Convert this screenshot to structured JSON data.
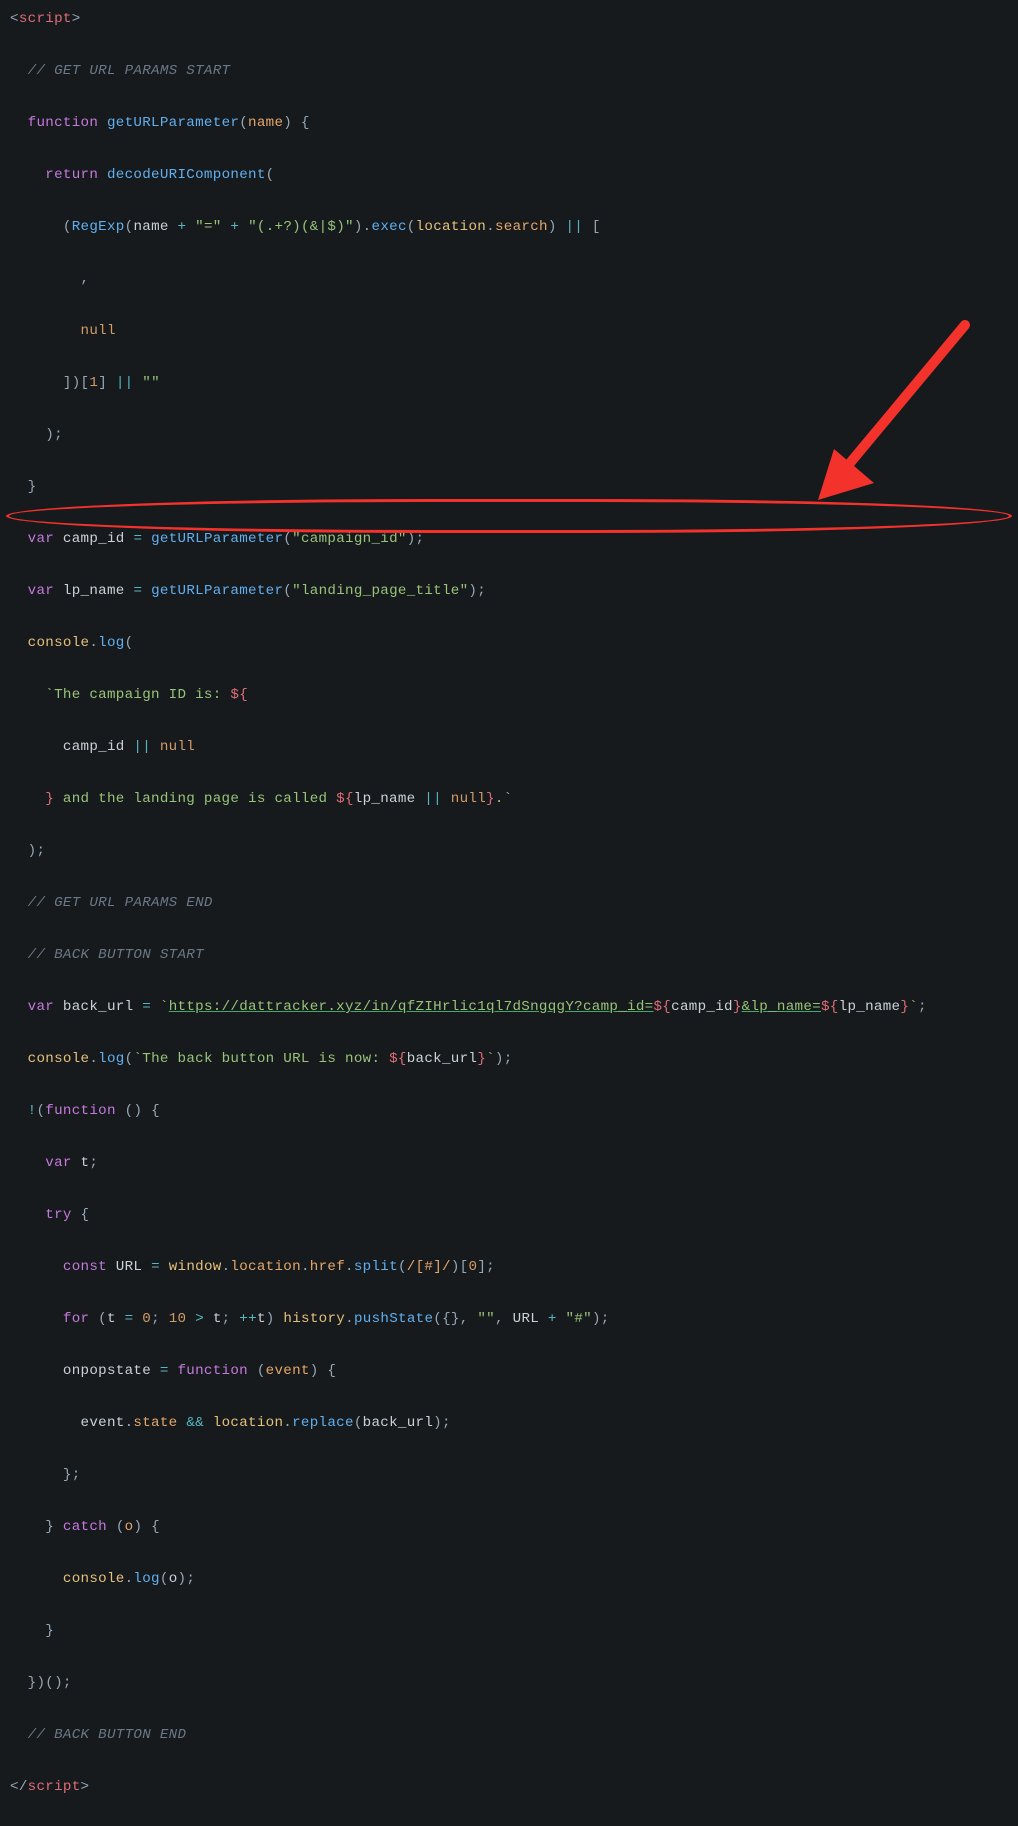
{
  "colors": {
    "bg": "#161a1d",
    "punc": "#96a7b6",
    "tag": "#e06c75",
    "comment": "#6b7886",
    "keyword": "#c678dd",
    "fn": "#61afef",
    "param": "#e5a66a",
    "string": "#98c379",
    "number": "#d19a66",
    "op": "#56b6c2",
    "builtin": "#e5c07b",
    "annotation_red": "#f3322c"
  },
  "tokens": {
    "open_tag_lt": "<",
    "open_tag_name": "script",
    "open_tag_gt": ">",
    "c_params_start": "// GET URL PARAMS START",
    "kw_function": "function",
    "fn_getURLParameter": "getURLParameter",
    "lp1_open": "(",
    "param_name": "name",
    "lp1_close": ") {",
    "kw_return": "return",
    "fn_decode": "decodeURIComponent",
    "lp2": "(",
    "lp3_open": "(",
    "fn_regexp": "RegExp",
    "lp4_open": "(",
    "re_name": "name",
    "op_plus1": " + ",
    "str_eq": "\"=\"",
    "op_plus2": " + ",
    "str_regex": "\"(.+?)(&|$)\"",
    "lp4_close": ")",
    "dot1": ".",
    "fn_exec": "exec",
    "lp5_open": "(",
    "var_location": "location",
    "dot2": ".",
    "prop_search": "search",
    "lp5_close": ")",
    "op_or1": " || ",
    "br1_open": "[",
    "comma_blank": ",",
    "kw_null1": "null",
    "br1_close": "])",
    "br_idx_open": "[",
    "num_1": "1",
    "br_idx_close": "]",
    "op_or2": " || ",
    "str_empty": "\"\"",
    "lp2_close": ");",
    "brace_close1": "}",
    "kw_var1": "var",
    "var_camp_id": "camp_id",
    "eq1": " = ",
    "fn_gup1": "getURLParameter",
    "lp6_open": "(",
    "str_campaign_id": "\"campaign_id\"",
    "lp6_close": ");",
    "kw_var2": "var",
    "var_lp_name": "lp_name",
    "eq2": " = ",
    "fn_gup2": "getURLParameter",
    "lp7_open": "(",
    "str_lpt": "\"landing_page_title\"",
    "lp7_close": ");",
    "var_console1": "console",
    "dot3": ".",
    "fn_log1": "log",
    "lp8_open": "(",
    "tpl_tick1": "`",
    "tpl_seg1": "The campaign ID is: ",
    "intp_open1": "${",
    "intp_body1a": "camp_id",
    "intp_or1": " || ",
    "intp_null1": "null",
    "intp_close1": "}",
    "tpl_seg2": " and the landing page is called ",
    "intp_open2": "${",
    "intp_body2a": "lp_name",
    "intp_or2": " || ",
    "intp_null2": "null",
    "intp_close2": "}",
    "tpl_seg3": ".",
    "tpl_tick2": "`",
    "lp8_close": ");",
    "c_params_end": "// GET URL PARAMS END",
    "c_back_start": "// BACK BUTTON START",
    "kw_var3": "var",
    "var_back_url": "back_url",
    "eq3": " = ",
    "tpl_tick3": "`",
    "tpl_url": "https://dattracker.xyz/in/qfZIHrlic1ql7dSngqgY?camp_id=",
    "intp_open3": "${",
    "intp_camp": "camp_id",
    "intp_close3": "}",
    "tpl_url2": "&lp_name=",
    "intp_open4": "${",
    "intp_lp": "lp_name",
    "intp_close4": "}",
    "tpl_tick4": "`",
    "semi1": ";",
    "var_console2": "console",
    "dot4": ".",
    "fn_log2": "log",
    "lp9_open": "(",
    "tpl_tick5": "`",
    "tpl_back_seg1": "The back button URL is now: ",
    "intp_open5": "${",
    "intp_bu": "back_url",
    "intp_close5": "}",
    "tpl_tick6": "`",
    "lp9_close": ");",
    "bang": "!",
    "lp10_open": "(",
    "kw_function2": "function",
    "lp11": " () {",
    "kw_var4": "var",
    "var_t": "t",
    "semi2": ";",
    "kw_try": "try",
    "brace2": " {",
    "kw_const": "const",
    "var_URL": "URL",
    "eq4": " = ",
    "var_window": "window",
    "dot5": ".",
    "prop_location": "location",
    "dot6": ".",
    "prop_href": "href",
    "dot7": ".",
    "fn_split": "split",
    "lp12_open": "(",
    "re_lit": "/[#]/",
    "lp12_close": ")[",
    "num_0": "0",
    "br2_close": "];",
    "kw_for": "for",
    "lp13_open": " (",
    "for_t": "t",
    "eq5": " = ",
    "num0b": "0",
    "semi3": "; ",
    "num10": "10",
    "op_gt": " > ",
    "for_t2": "t",
    "semi4": "; ",
    "op_pp": "++",
    "for_t3": "t",
    "lp13_close": ") ",
    "var_history": "history",
    "dot8": ".",
    "fn_push": "pushState",
    "lp14_open": "({}, ",
    "str_q1": "\"\"",
    "comma2": ", ",
    "var_URL2": "URL",
    "op_plus3": " + ",
    "str_hash": "\"#\"",
    "lp14_close": ");",
    "var_onpop": "onpopstate",
    "eq6": " = ",
    "kw_function3": "function",
    "lp15_open": " (",
    "param_event": "event",
    "lp15_close": ") {",
    "var_event": "event",
    "dot9": ".",
    "prop_state": "state",
    "op_and": " && ",
    "var_location2": "location",
    "dot10": ".",
    "fn_replace": "replace",
    "lp16_open": "(",
    "var_back_url2": "back_url",
    "lp16_close": ");",
    "brace3": "};",
    "brace4": "}",
    "kw_catch": "catch",
    "lp17_open": " (",
    "param_o": "o",
    "lp17_close": ") {",
    "var_console3": "console",
    "dot11": ".",
    "fn_log3": "log",
    "lp18_open": "(",
    "var_o": "o",
    "lp18_close": ");",
    "brace5": "}",
    "brace6": "})();",
    "c_back_end": "// BACK BUTTON END",
    "close_tag_lt": "</",
    "close_tag_name": "script",
    "close_tag_gt": ">"
  },
  "annotation": {
    "arrow_label": "red-arrow",
    "ellipse_label": "red-highlight-ellipse"
  }
}
